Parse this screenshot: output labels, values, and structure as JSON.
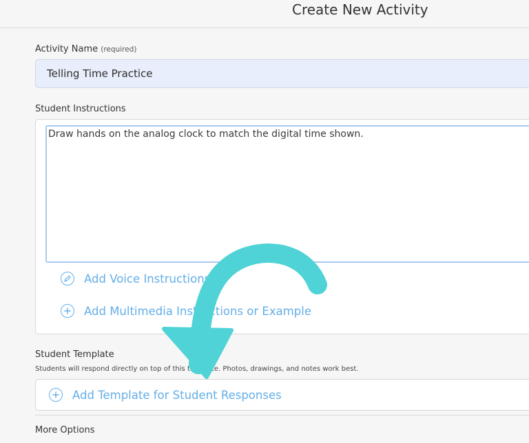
{
  "header": {
    "title": "Create New Activity"
  },
  "activity_name": {
    "label": "Activity Name",
    "required_note": "(required)",
    "value": "Telling Time Practice"
  },
  "student_instructions": {
    "label": "Student Instructions",
    "value": "Draw hands on the analog clock to match the digital time shown.",
    "add_voice_label": "Add Voice Instructions",
    "add_multimedia_label": "Add Multimedia Instructions or Example"
  },
  "student_template": {
    "label": "Student Template",
    "note": "Students will respond directly on top of this template. Photos, drawings, and notes work best.",
    "add_template_label": "Add Template for Student Responses"
  },
  "more_options": {
    "label": "More Options"
  },
  "colors": {
    "link": "#63aee8",
    "arrow": "#4fd3d6",
    "input_bg": "#e8eefb"
  },
  "icons": {
    "voice": "pencil-icon",
    "add": "plus-circle-icon"
  }
}
